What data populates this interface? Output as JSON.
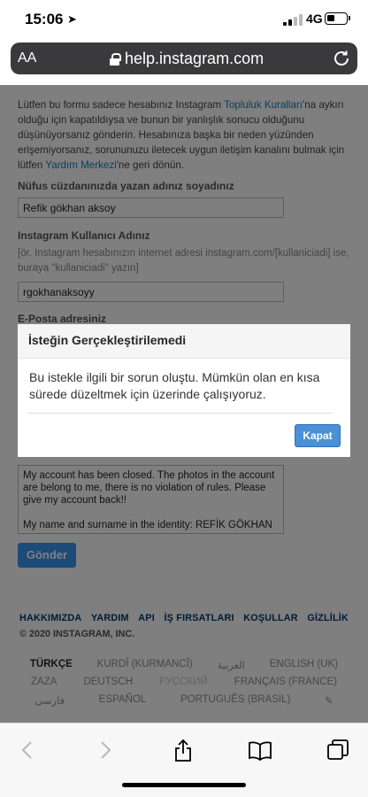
{
  "status": {
    "time": "15:06",
    "network": "4G"
  },
  "browser": {
    "text_size_label": "AA",
    "url": "help.instagram.com"
  },
  "form": {
    "intro_before": "Lütfen bu formu sadece hesabınız Instagram ",
    "intro_link1": "Topluluk Kuralları",
    "intro_mid": "'na aykırı olduğu için kapatıldıysa ve bunun bir yanlışlık sonucu olduğunu düşünüyorsanız gönderin. Hesabınıza başka bir neden yüzünden erişemiyorsanız, sorununuzu iletecek uygun iletişim kanalını bulmak için lütfen ",
    "intro_link2": "Yardım Merkezi",
    "intro_after": "'ne geri dönün.",
    "name_label": "Nüfus cüzdanınızda yazan adınız soyadınız",
    "name_value": "Refik gökhan aksoy",
    "username_label": "Instagram Kullanıcı Adınız",
    "username_hint": "[ör. Instagram hesabınızın internet adresi instagram.com/[kullaniciadi] ise, buraya \"kullaniciadi\" yazın]",
    "username_value": "rgokhanaksoyy",
    "email_label": "E-Posta adresiniz",
    "message_value": "My account has been closed. The photos in the account are belong to me, there is no violation of rules. Please give my account back!!\n\nMy name and surname in the identity: REFİK GÖKHAN",
    "submit_label": "Gönder"
  },
  "footer": {
    "links": [
      "HAKKIMIZDA",
      "YARDIM",
      "API",
      "İŞ FIRSATLARI",
      "KOŞULLAR",
      "GİZLİLİK"
    ],
    "copyright": "© 2020 INSTAGRAM, INC.",
    "languages_row1": [
      "TÜRKÇE",
      "KURDÎ (KURMANCÎ)",
      "العربية",
      "ENGLISH (UK)"
    ],
    "languages_row2": [
      "ZAZA",
      "DEUTSCH",
      "РУССКИЙ",
      "FRANÇAIS (FRANCE)"
    ],
    "languages_row3": [
      "فارسی",
      "ESPAÑOL",
      "PORTUGUÊS (BRASIL)"
    ]
  },
  "modal": {
    "title": "İsteğin Gerçekleştirilemedi",
    "body": "Bu istekle ilgili bir sorun oluştu. Mümkün olan en kısa sürede düzeltmek için üzerinde çalışıyoruz.",
    "close_label": "Kapat"
  },
  "colors": {
    "link": "#0d7ec2",
    "button": "#3897f0",
    "address_bar": "#3a3a3c"
  },
  "icons": [
    "location-arrow-icon",
    "lock-icon",
    "reload-icon",
    "back-icon",
    "forward-icon",
    "share-icon",
    "bookmarks-icon",
    "tabs-icon",
    "pencil-icon"
  ]
}
